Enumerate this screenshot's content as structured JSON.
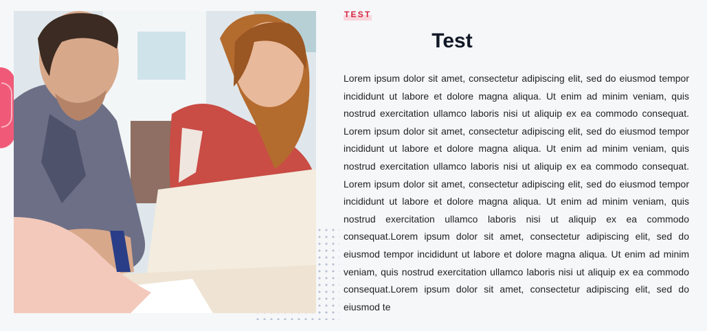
{
  "section": {
    "eyebrow": "TEST",
    "title": "Test",
    "paragraph": "Lorem ipsum dolor sit amet, consectetur adipiscing elit, sed do eiusmod tempor incididunt ut labore et dolore magna aliqua. Ut enim ad minim veniam, quis nostrud exercitation ullamco laboris nisi ut aliquip ex ea commodo consequat. Lorem ipsum dolor sit amet, consectetur adipiscing elit, sed do eiusmod tempor incididunt ut labore et dolore magna aliqua. Ut enim ad minim veniam, quis nostrud exercitation ullamco laboris nisi ut aliquip ex ea commodo consequat. Lorem ipsum dolor sit amet, consectetur adipiscing elit, sed do eiusmod tempor incididunt ut labore et dolore magna aliqua. Ut enim ad minim veniam, quis nostrud exercitation ullamco laboris nisi ut aliquip ex ea commodo consequat.Lorem ipsum dolor sit amet, consectetur adipiscing elit, sed do eiusmod tempor incididunt ut labore et dolore magna aliqua. Ut enim ad minim veniam, quis nostrud exercitation ullamco laboris nisi ut aliquip ex ea commodo consequat.Lorem ipsum dolor sit amet, consectetur adipiscing elit, sed do eiusmod te"
  },
  "colors": {
    "accent": "#d4233f",
    "decoration_pink": "#f05a78",
    "background": "#f6f7f9",
    "heading": "#111827"
  },
  "icons": {
    "photo": "students-laptop-photo",
    "decoration": "dot-grid-pattern"
  }
}
